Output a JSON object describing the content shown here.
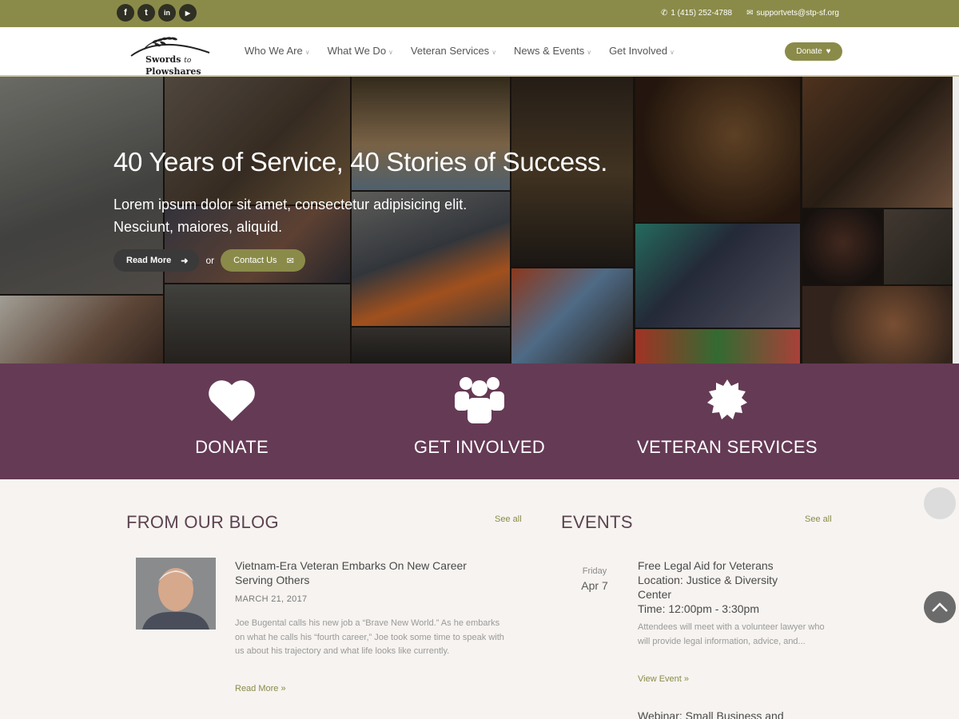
{
  "topbar": {
    "social": [
      {
        "icon": "facebook-icon",
        "glyph": "f"
      },
      {
        "icon": "twitter-icon",
        "glyph": "t"
      },
      {
        "icon": "linkedin-icon",
        "glyph": "in"
      },
      {
        "icon": "youtube-icon",
        "glyph": "▶"
      }
    ],
    "phone": "1 (415) 252-4788",
    "email": "supportvets@stp-sf.org"
  },
  "logo": {
    "line1": "Swords",
    "to": "to",
    "line2": "Plowshares"
  },
  "nav": {
    "items": [
      "Who We Are",
      "What We Do",
      "Veteran Services",
      "News & Events",
      "Get Involved"
    ],
    "donate": "Donate"
  },
  "hero": {
    "title": "40 Years of Service, 40 Stories of Success.",
    "subtitle": "Lorem ipsum dolor sit amet, consectetur adipisicing elit. Nesciunt, maiores, aliquid.",
    "read_more": "Read More",
    "or": "or",
    "contact": "Contact Us"
  },
  "features": [
    {
      "label": "DONATE",
      "icon": "heart-icon"
    },
    {
      "label": "GET INVOLVED",
      "icon": "group-icon"
    },
    {
      "label": "VETERAN SERVICES",
      "icon": "badge-icon"
    }
  ],
  "blog": {
    "title": "FROM OUR BLOG",
    "see_all": "See all",
    "post": {
      "title": "Vietnam-Era Veteran Embarks On New Career Serving Others",
      "date": "MARCH 21, 2017",
      "excerpt": "Joe Bugental calls his new job a “Brave New World.” As he embarks on what he calls his “fourth career,” Joe took some time to speak with us about his trajectory and what life looks like currently.",
      "more": "Read More »"
    }
  },
  "events": {
    "title": "EVENTS",
    "see_all": "See all",
    "event": {
      "day": "Friday",
      "date": "Apr 7",
      "title_lines": [
        "Free Legal Aid for Veterans",
        "Location: Justice & Diversity",
        "Center",
        "Time: 12:00pm - 3:30pm"
      ],
      "excerpt": "Attendees will meet with a volunteer lawyer who will provide legal information, advice, and...",
      "more": "View Event »"
    },
    "next_title": "Webinar: Small Business and"
  },
  "colors": {
    "olive": "#8a8b49",
    "plum": "#653a55",
    "background": "#f6f3f0"
  }
}
